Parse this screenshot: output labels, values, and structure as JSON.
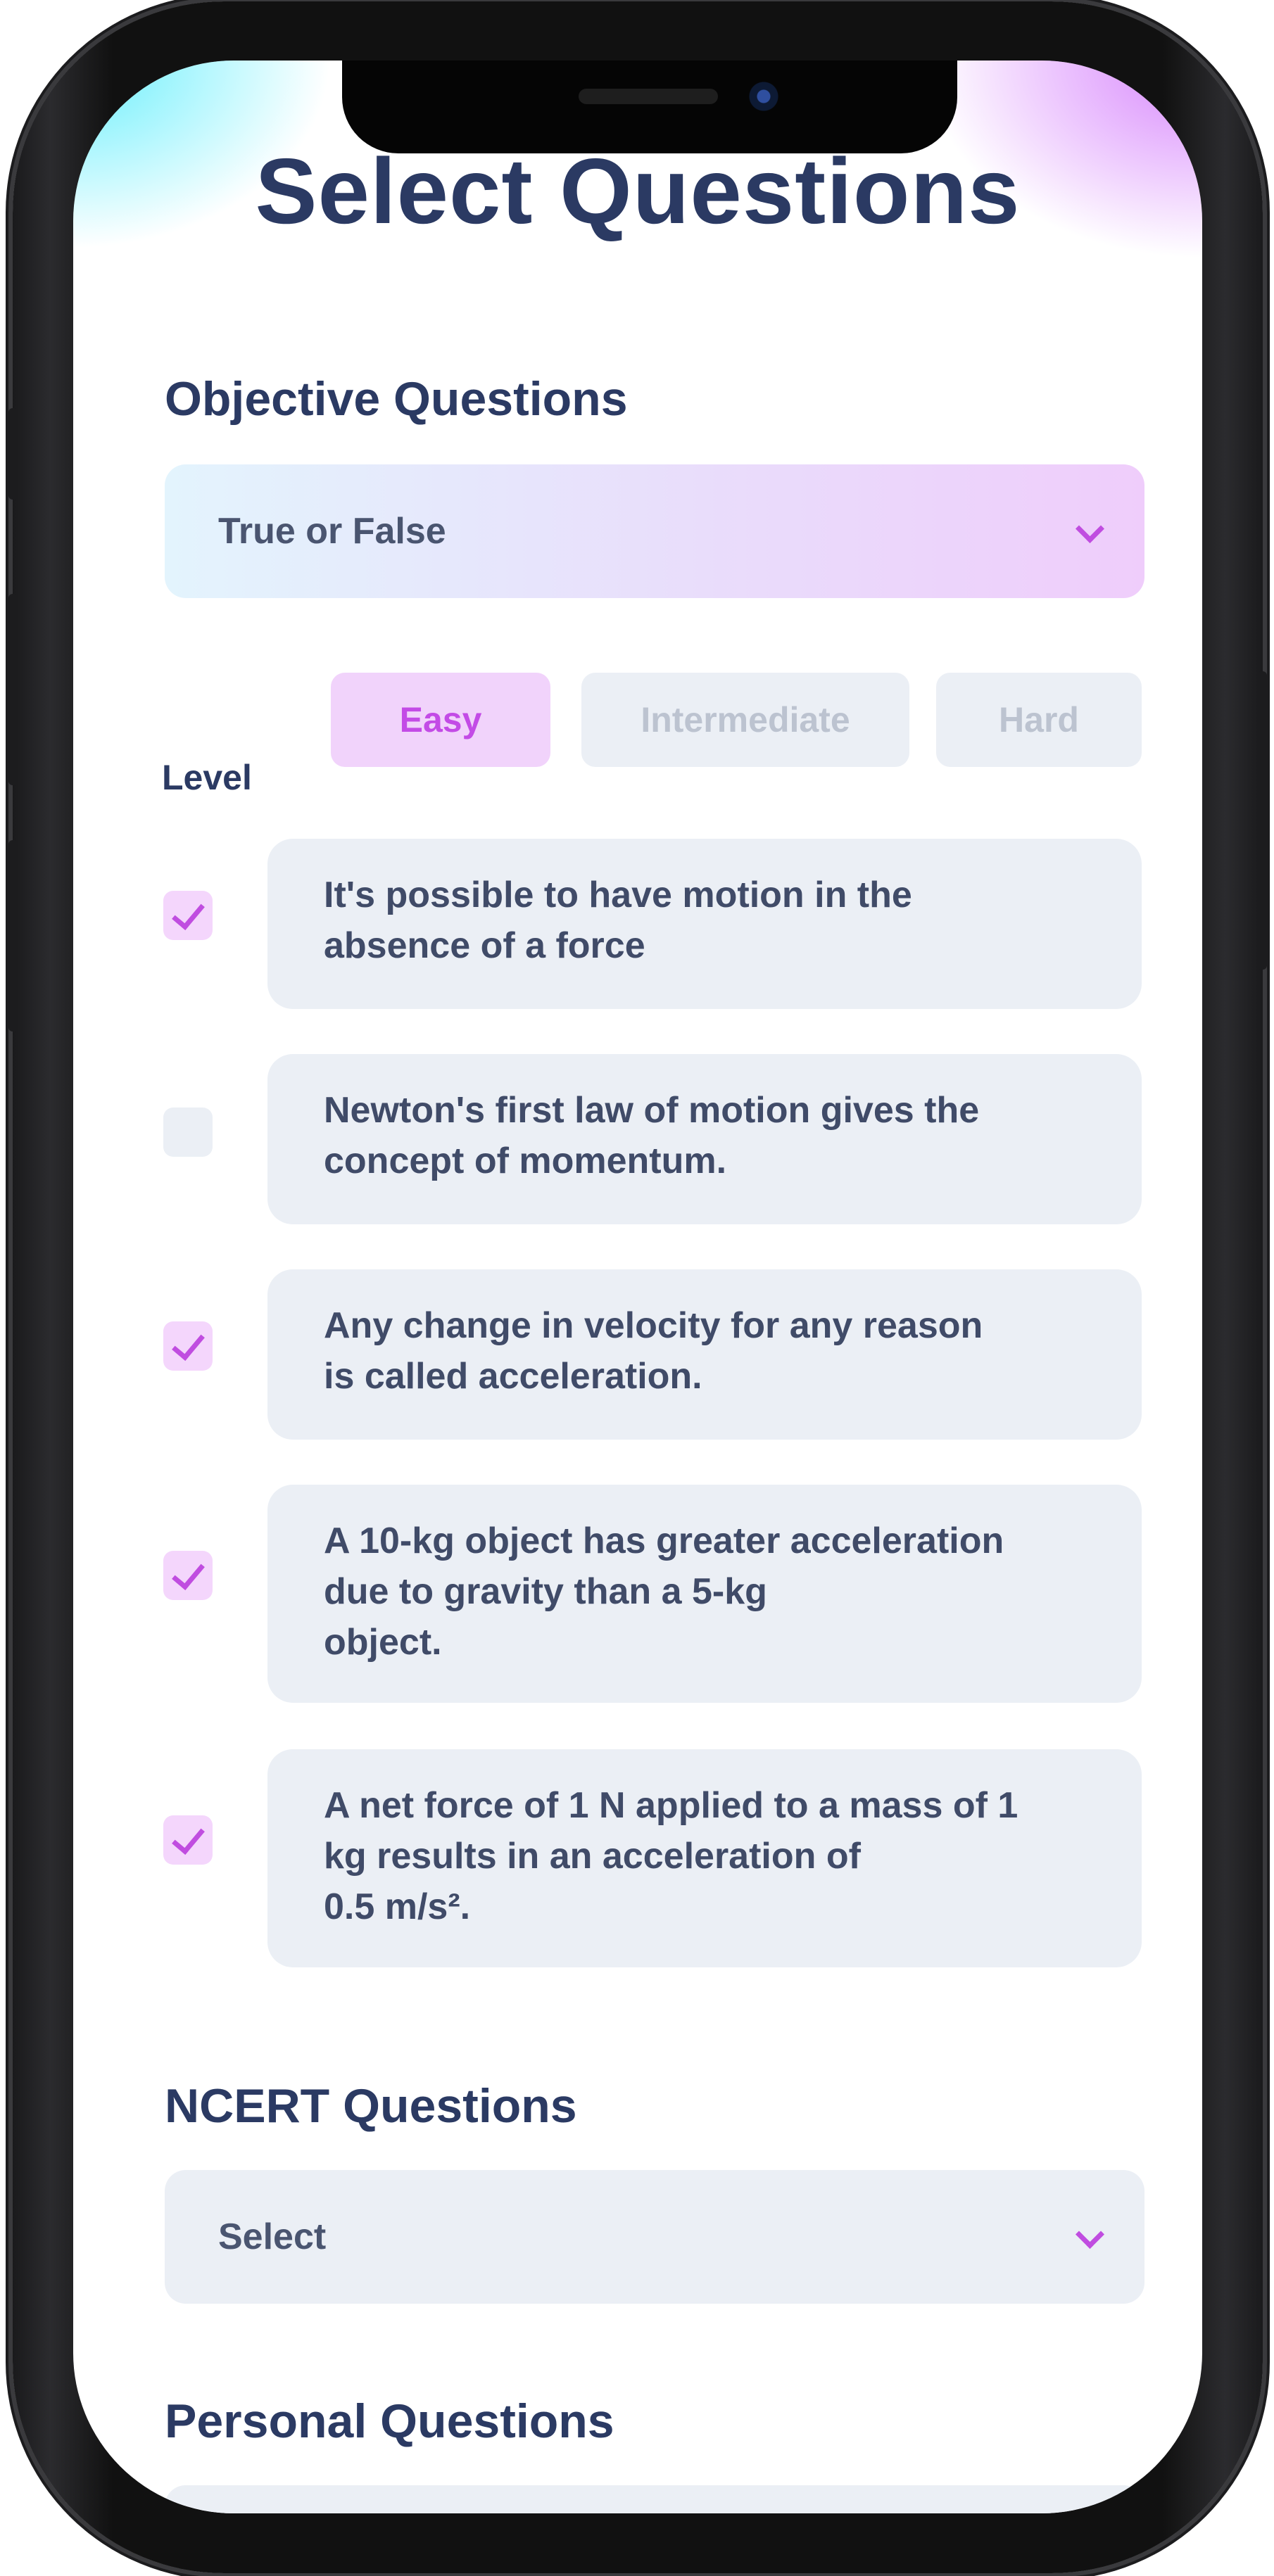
{
  "page": {
    "title": "Select Questions"
  },
  "objective": {
    "section_title": "Objective Questions",
    "dropdown_value": "True or False",
    "level_label": "Level",
    "levels": [
      {
        "label": "Easy",
        "selected": true
      },
      {
        "label": "Intermediate",
        "selected": false
      },
      {
        "label": "Hard",
        "selected": false
      }
    ],
    "questions": [
      {
        "text": "It's possible to have motion in the\nabsence of a force",
        "checked": true
      },
      {
        "text": "Newton's first law of motion gives the\nconcept of momentum.",
        "checked": false
      },
      {
        "text": "Any change in velocity for any reason\nis called acceleration.",
        "checked": true
      },
      {
        "text": "A 10-kg object has greater acceleration\ndue to gravity than a 5-kg\nobject.",
        "checked": true
      },
      {
        "text": "A net force of 1 N applied to a mass of 1\nkg results in an acceleration of\n0.5 m/s².",
        "checked": true
      }
    ]
  },
  "ncert": {
    "section_title": "NCERT Questions",
    "dropdown_value": "Select"
  },
  "personal": {
    "section_title": "Personal Questions"
  },
  "colors": {
    "title_navy": "#2b3a63",
    "accent_purple": "#c04de0",
    "accent_light": "#f1d3fb",
    "card_gray": "#ebeff5"
  },
  "icons": {
    "dropdown": "chevron-down-icon",
    "check": "checkmark-icon"
  }
}
